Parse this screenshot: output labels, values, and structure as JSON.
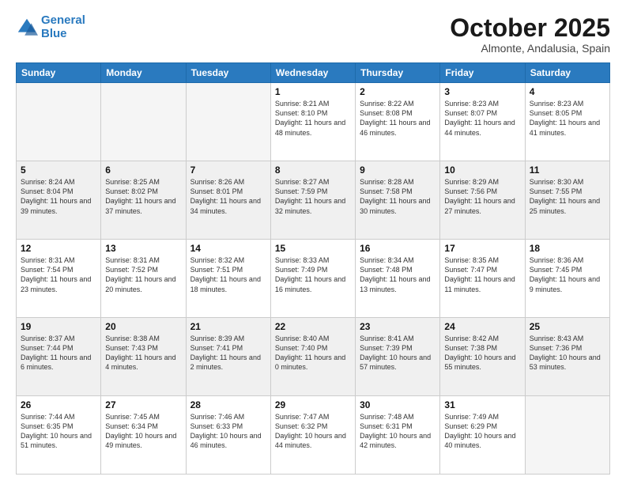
{
  "logo": {
    "line1": "General",
    "line2": "Blue"
  },
  "title": "October 2025",
  "subtitle": "Almonte, Andalusia, Spain",
  "headers": [
    "Sunday",
    "Monday",
    "Tuesday",
    "Wednesday",
    "Thursday",
    "Friday",
    "Saturday"
  ],
  "weeks": [
    [
      {
        "day": "",
        "info": ""
      },
      {
        "day": "",
        "info": ""
      },
      {
        "day": "",
        "info": ""
      },
      {
        "day": "1",
        "info": "Sunrise: 8:21 AM\nSunset: 8:10 PM\nDaylight: 11 hours\nand 48 minutes."
      },
      {
        "day": "2",
        "info": "Sunrise: 8:22 AM\nSunset: 8:08 PM\nDaylight: 11 hours\nand 46 minutes."
      },
      {
        "day": "3",
        "info": "Sunrise: 8:23 AM\nSunset: 8:07 PM\nDaylight: 11 hours\nand 44 minutes."
      },
      {
        "day": "4",
        "info": "Sunrise: 8:23 AM\nSunset: 8:05 PM\nDaylight: 11 hours\nand 41 minutes."
      }
    ],
    [
      {
        "day": "5",
        "info": "Sunrise: 8:24 AM\nSunset: 8:04 PM\nDaylight: 11 hours\nand 39 minutes."
      },
      {
        "day": "6",
        "info": "Sunrise: 8:25 AM\nSunset: 8:02 PM\nDaylight: 11 hours\nand 37 minutes."
      },
      {
        "day": "7",
        "info": "Sunrise: 8:26 AM\nSunset: 8:01 PM\nDaylight: 11 hours\nand 34 minutes."
      },
      {
        "day": "8",
        "info": "Sunrise: 8:27 AM\nSunset: 7:59 PM\nDaylight: 11 hours\nand 32 minutes."
      },
      {
        "day": "9",
        "info": "Sunrise: 8:28 AM\nSunset: 7:58 PM\nDaylight: 11 hours\nand 30 minutes."
      },
      {
        "day": "10",
        "info": "Sunrise: 8:29 AM\nSunset: 7:56 PM\nDaylight: 11 hours\nand 27 minutes."
      },
      {
        "day": "11",
        "info": "Sunrise: 8:30 AM\nSunset: 7:55 PM\nDaylight: 11 hours\nand 25 minutes."
      }
    ],
    [
      {
        "day": "12",
        "info": "Sunrise: 8:31 AM\nSunset: 7:54 PM\nDaylight: 11 hours\nand 23 minutes."
      },
      {
        "day": "13",
        "info": "Sunrise: 8:31 AM\nSunset: 7:52 PM\nDaylight: 11 hours\nand 20 minutes."
      },
      {
        "day": "14",
        "info": "Sunrise: 8:32 AM\nSunset: 7:51 PM\nDaylight: 11 hours\nand 18 minutes."
      },
      {
        "day": "15",
        "info": "Sunrise: 8:33 AM\nSunset: 7:49 PM\nDaylight: 11 hours\nand 16 minutes."
      },
      {
        "day": "16",
        "info": "Sunrise: 8:34 AM\nSunset: 7:48 PM\nDaylight: 11 hours\nand 13 minutes."
      },
      {
        "day": "17",
        "info": "Sunrise: 8:35 AM\nSunset: 7:47 PM\nDaylight: 11 hours\nand 11 minutes."
      },
      {
        "day": "18",
        "info": "Sunrise: 8:36 AM\nSunset: 7:45 PM\nDaylight: 11 hours\nand 9 minutes."
      }
    ],
    [
      {
        "day": "19",
        "info": "Sunrise: 8:37 AM\nSunset: 7:44 PM\nDaylight: 11 hours\nand 6 minutes."
      },
      {
        "day": "20",
        "info": "Sunrise: 8:38 AM\nSunset: 7:43 PM\nDaylight: 11 hours\nand 4 minutes."
      },
      {
        "day": "21",
        "info": "Sunrise: 8:39 AM\nSunset: 7:41 PM\nDaylight: 11 hours\nand 2 minutes."
      },
      {
        "day": "22",
        "info": "Sunrise: 8:40 AM\nSunset: 7:40 PM\nDaylight: 11 hours\nand 0 minutes."
      },
      {
        "day": "23",
        "info": "Sunrise: 8:41 AM\nSunset: 7:39 PM\nDaylight: 10 hours\nand 57 minutes."
      },
      {
        "day": "24",
        "info": "Sunrise: 8:42 AM\nSunset: 7:38 PM\nDaylight: 10 hours\nand 55 minutes."
      },
      {
        "day": "25",
        "info": "Sunrise: 8:43 AM\nSunset: 7:36 PM\nDaylight: 10 hours\nand 53 minutes."
      }
    ],
    [
      {
        "day": "26",
        "info": "Sunrise: 7:44 AM\nSunset: 6:35 PM\nDaylight: 10 hours\nand 51 minutes."
      },
      {
        "day": "27",
        "info": "Sunrise: 7:45 AM\nSunset: 6:34 PM\nDaylight: 10 hours\nand 49 minutes."
      },
      {
        "day": "28",
        "info": "Sunrise: 7:46 AM\nSunset: 6:33 PM\nDaylight: 10 hours\nand 46 minutes."
      },
      {
        "day": "29",
        "info": "Sunrise: 7:47 AM\nSunset: 6:32 PM\nDaylight: 10 hours\nand 44 minutes."
      },
      {
        "day": "30",
        "info": "Sunrise: 7:48 AM\nSunset: 6:31 PM\nDaylight: 10 hours\nand 42 minutes."
      },
      {
        "day": "31",
        "info": "Sunrise: 7:49 AM\nSunset: 6:29 PM\nDaylight: 10 hours\nand 40 minutes."
      },
      {
        "day": "",
        "info": ""
      }
    ]
  ]
}
